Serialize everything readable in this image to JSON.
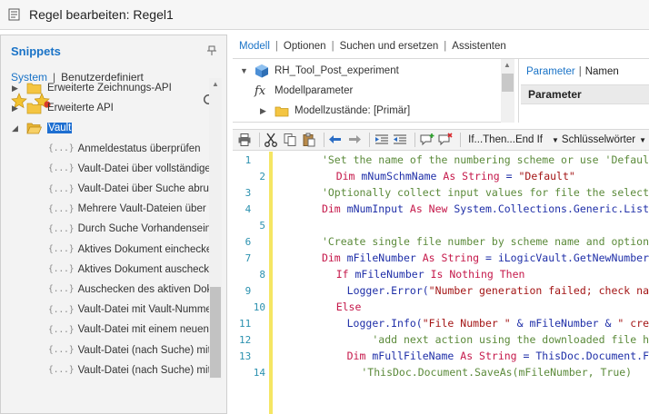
{
  "window": {
    "title": "Regel bearbeiten: Regel1"
  },
  "snippets": {
    "title": "Snippets",
    "tabs": {
      "system": "System",
      "user": "Benutzerdefiniert"
    },
    "tree": [
      {
        "label": "Erweiterte Zeichnungs-API",
        "type": "folder",
        "expanded": false
      },
      {
        "label": "Erweiterte API",
        "type": "folder",
        "expanded": false
      },
      {
        "label": "Vault",
        "type": "folder",
        "expanded": true,
        "selected": true
      }
    ],
    "vault_items": [
      "Anmeldestatus überprüfen",
      "Vault-Datei über vollständigen Da",
      "Vault-Datei über Suche abrufen",
      "Mehrere Vault-Dateien über Such",
      "Durch Suche Vorhandensein von",
      "Aktives Dokument einchecken",
      "Aktives Dokument auschecken",
      "Auschecken des aktiven Dokume",
      "Vault-Datei mit Vault-Nummerieru",
      "Vault-Datei mit einem neuen Date",
      "Vault-Datei (nach Suche) mit Vau",
      "Vault-Datei (nach Suche) mit eine"
    ],
    "snippet_glyph": "{...}"
  },
  "tabs": {
    "model": "Modell",
    "options": "Optionen",
    "search": "Suchen und ersetzen",
    "wizards": "Assistenten"
  },
  "model_tree": {
    "root": "RH_Tool_Post_experiment",
    "params": "Modellparameter",
    "states": "Modellzustände: [Primär]",
    "fx": "fx"
  },
  "param_panel": {
    "tab_params": "Parameter",
    "tab_names": "Namen",
    "header": "Parameter"
  },
  "toolbar": {
    "ifthen": "If...Then...End If",
    "keywords": "Schlüsselwörter"
  },
  "code_lines": [
    {
      "n": "1",
      "tokens": [
        {
          "t": "cmt",
          "v": "    'Set the name of the numbering scheme or use 'Defaul"
        }
      ]
    },
    {
      "n": "2",
      "tokens": [
        {
          "t": "kw",
          "v": "    Dim"
        },
        {
          "t": "tx",
          "v": " mNumSchmName "
        },
        {
          "t": "kw",
          "v": "As String"
        },
        {
          "t": "tx",
          "v": " = "
        },
        {
          "t": "str",
          "v": "\"Default\""
        }
      ]
    },
    {
      "n": "3",
      "tokens": [
        {
          "t": "cmt",
          "v": "    'Optionally collect input values for file the select"
        }
      ]
    },
    {
      "n": "4",
      "tokens": [
        {
          "t": "kw",
          "v": "    Dim"
        },
        {
          "t": "tx",
          "v": " mNumInput "
        },
        {
          "t": "kw",
          "v": "As New"
        },
        {
          "t": "tx",
          "v": " System.Collections.Generic.List"
        }
      ]
    },
    {
      "n": "5",
      "tokens": [
        {
          "t": "tx",
          "v": ""
        }
      ]
    },
    {
      "n": "6",
      "tokens": [
        {
          "t": "cmt",
          "v": "    'Create single file number by scheme name and option"
        }
      ]
    },
    {
      "n": "7",
      "tokens": [
        {
          "t": "kw",
          "v": "    Dim"
        },
        {
          "t": "tx",
          "v": " mFileNumber "
        },
        {
          "t": "kw",
          "v": "As String"
        },
        {
          "t": "tx",
          "v": " = iLogicVault.GetNewNumber"
        }
      ]
    },
    {
      "n": "8",
      "tokens": [
        {
          "t": "kw",
          "v": "    If"
        },
        {
          "t": "tx",
          "v": " mFileNumber "
        },
        {
          "t": "kw",
          "v": "Is Nothing Then"
        }
      ]
    },
    {
      "n": "9",
      "tokens": [
        {
          "t": "tx",
          "v": "        Logger.Error("
        },
        {
          "t": "str",
          "v": "\"Number generation failed; check na"
        }
      ]
    },
    {
      "n": "10",
      "tokens": [
        {
          "t": "kw",
          "v": "    Else"
        }
      ]
    },
    {
      "n": "11",
      "tokens": [
        {
          "t": "tx",
          "v": "        Logger.Info("
        },
        {
          "t": "str",
          "v": "\"File Number \""
        },
        {
          "t": "tx",
          "v": " & mFileNumber & "
        },
        {
          "t": "str",
          "v": "\" cre"
        }
      ]
    },
    {
      "n": "12",
      "tokens": [
        {
          "t": "cmt",
          "v": "            'add next action using the downloaded file h"
        }
      ]
    },
    {
      "n": "13",
      "tokens": [
        {
          "t": "kw",
          "v": "        Dim"
        },
        {
          "t": "tx",
          "v": " mFullFileName "
        },
        {
          "t": "kw",
          "v": "As String"
        },
        {
          "t": "tx",
          "v": " = ThisDoc.Document.F"
        }
      ]
    },
    {
      "n": "14",
      "tokens": [
        {
          "t": "cmt",
          "v": "        'ThisDoc.Document.SaveAs(mFileNumber, True)"
        }
      ]
    }
  ]
}
